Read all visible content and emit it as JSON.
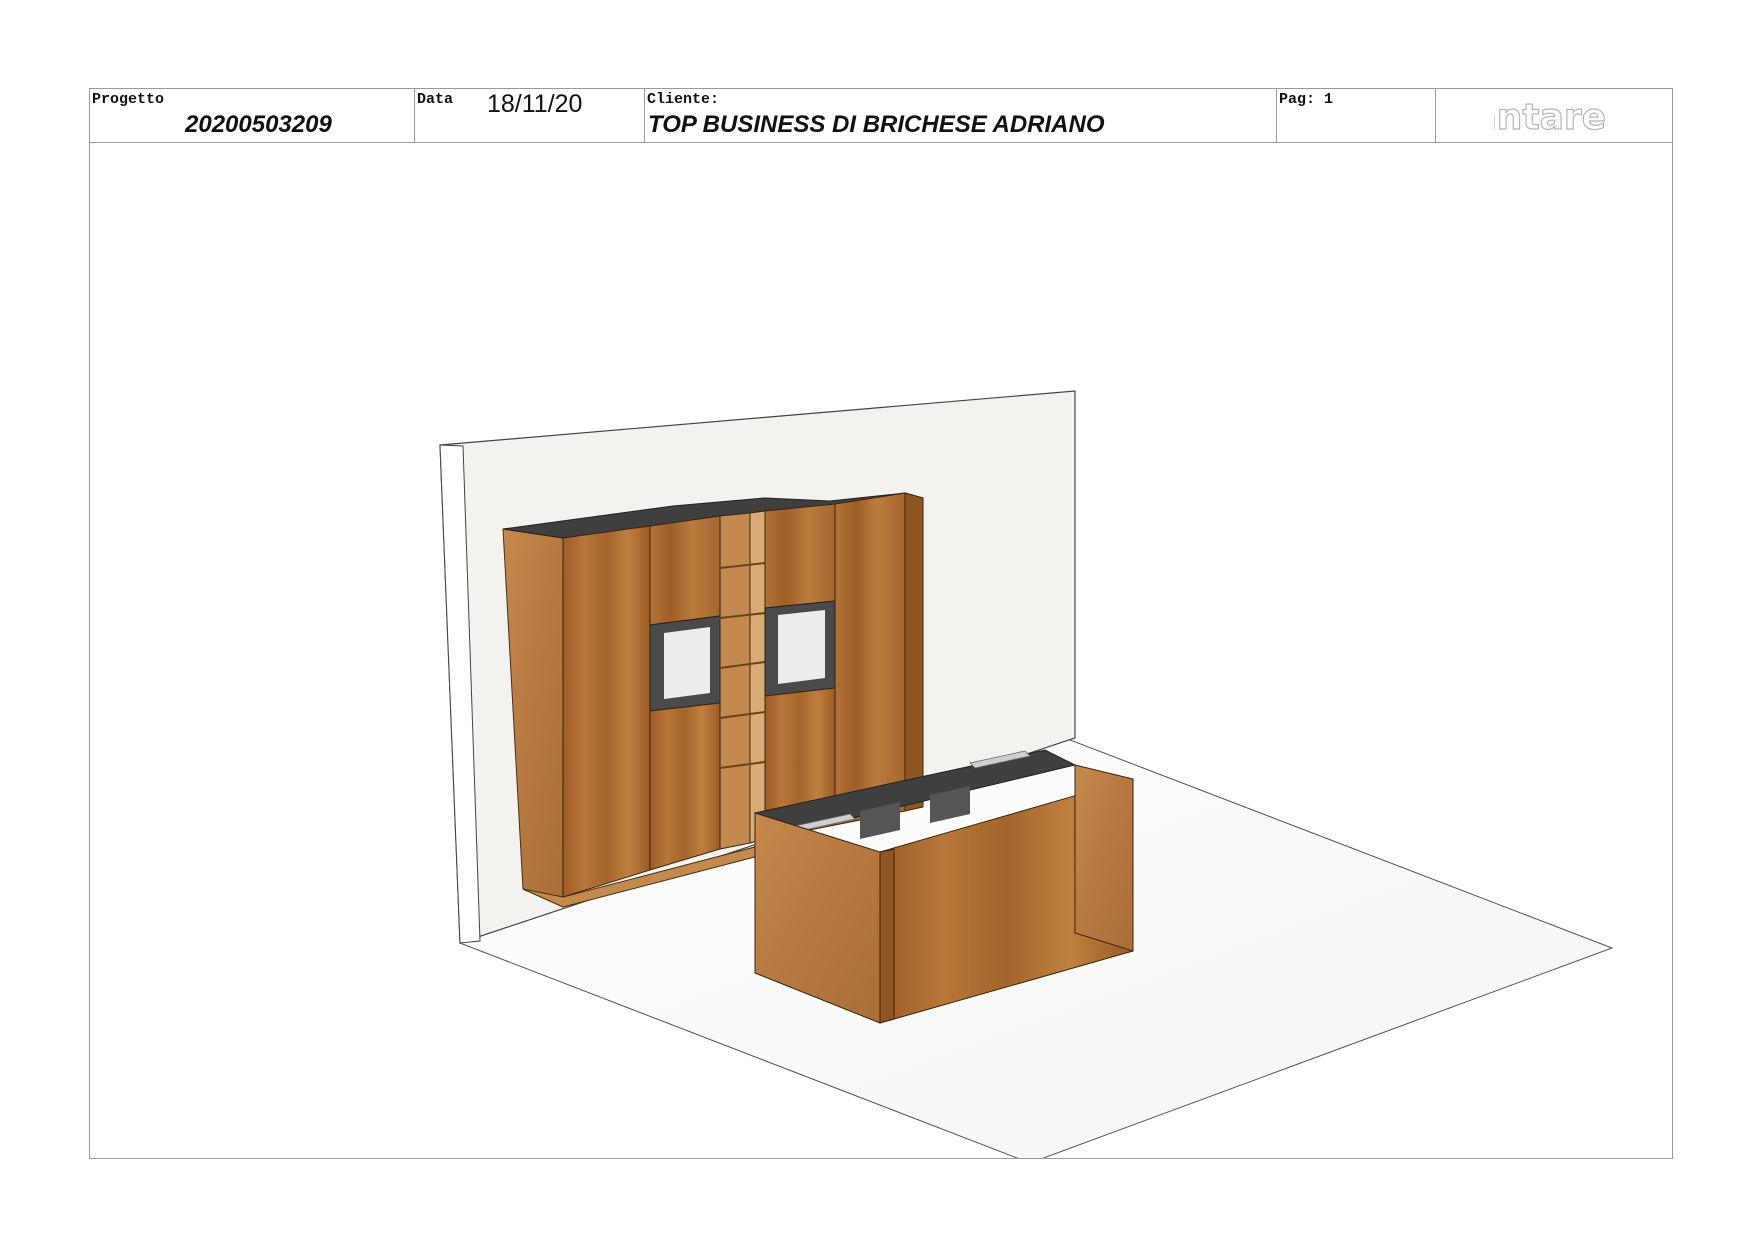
{
  "header": {
    "project_label": "Progetto",
    "project_value": "20200503209",
    "date_label": "Data",
    "date_value": "18/11/20",
    "client_label": "Cliente:",
    "client_value": "TOP BUSINESS DI BRICHESE ADRIANO",
    "page_label": "Pag: 1",
    "logo_text": "antares"
  },
  "colors": {
    "wood": "#a8692e",
    "wood_dark": "#8a5422",
    "wood_light": "#c08348",
    "interior": "#4a4a4a",
    "border": "#9a9a9a",
    "wall": "#f3f2ef",
    "logo": "#b5b5b5"
  },
  "icons": {
    "logo": "antares-logo"
  }
}
